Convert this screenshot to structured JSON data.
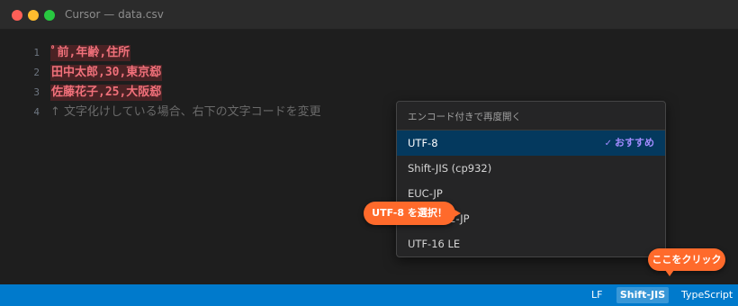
{
  "window": {
    "title": "Cursor — data.csv"
  },
  "editor": {
    "lines": [
      {
        "number": "1",
        "text": "ﾟ前,年齢,住所"
      },
      {
        "number": "2",
        "text": "田中太郎,30,東京郄"
      },
      {
        "number": "3",
        "text": "佐藤花子,25,大阪郄"
      },
      {
        "number": "4",
        "text": "↑ 文字化けしている場合、右下の文字コードを変更"
      }
    ]
  },
  "encoding_dropdown": {
    "header": "エンコード付きで再度開く",
    "items": [
      {
        "label": "UTF-8",
        "badge": "おすすめ",
        "badge_check": "✓"
      },
      {
        "label": "Shift-JIS (cp932)"
      },
      {
        "label": "EUC-JP"
      },
      {
        "label": "ISO-2022-JP"
      },
      {
        "label": "UTF-16 LE"
      }
    ]
  },
  "callouts": {
    "select_utf8": "UTF-8 を選択！",
    "click_here": "ここをクリック"
  },
  "statusbar": {
    "eol": "LF",
    "encoding": "Shift-JIS",
    "language": "TypeScript"
  },
  "colors": {
    "statusbar_bg": "#007acc",
    "callout_bg": "#ff6a2b",
    "error_text": "#f0707a",
    "selected_item_bg": "#04395e",
    "badge_text": "#a38bff"
  }
}
